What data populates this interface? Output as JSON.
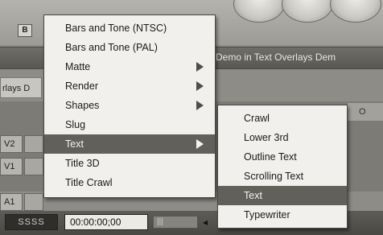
{
  "background": {
    "toolbar_button_label": "B",
    "title_text": "Demo in Text Overlays Dem",
    "left_label": "rlays D",
    "right_tab_label": "O",
    "track_labels": [
      "V2",
      "V1",
      "A1"
    ],
    "timecode_icon_label": "SSSS",
    "timecode": "00:00:00;00",
    "slider_text": "|||",
    "left_arrow": "◂"
  },
  "menu": {
    "items": [
      {
        "label": "Bars and Tone (NTSC)"
      },
      {
        "label": "Bars and Tone (PAL)"
      },
      {
        "label": "Matte"
      },
      {
        "label": "Render"
      },
      {
        "label": "Shapes"
      },
      {
        "label": "Slug"
      },
      {
        "label": "Text"
      },
      {
        "label": "Title 3D"
      },
      {
        "label": "Title Crawl"
      }
    ],
    "selected": "Text"
  },
  "submenu": {
    "items": [
      {
        "label": "Crawl"
      },
      {
        "label": "Lower 3rd"
      },
      {
        "label": "Outline Text"
      },
      {
        "label": "Scrolling Text"
      },
      {
        "label": "Text"
      },
      {
        "label": "Typewriter"
      }
    ],
    "selected": "Text"
  },
  "colors": {
    "menu_bg": "#f1f0ec",
    "selection_bg": "#62605b",
    "app_bg": "#8e8c87"
  }
}
